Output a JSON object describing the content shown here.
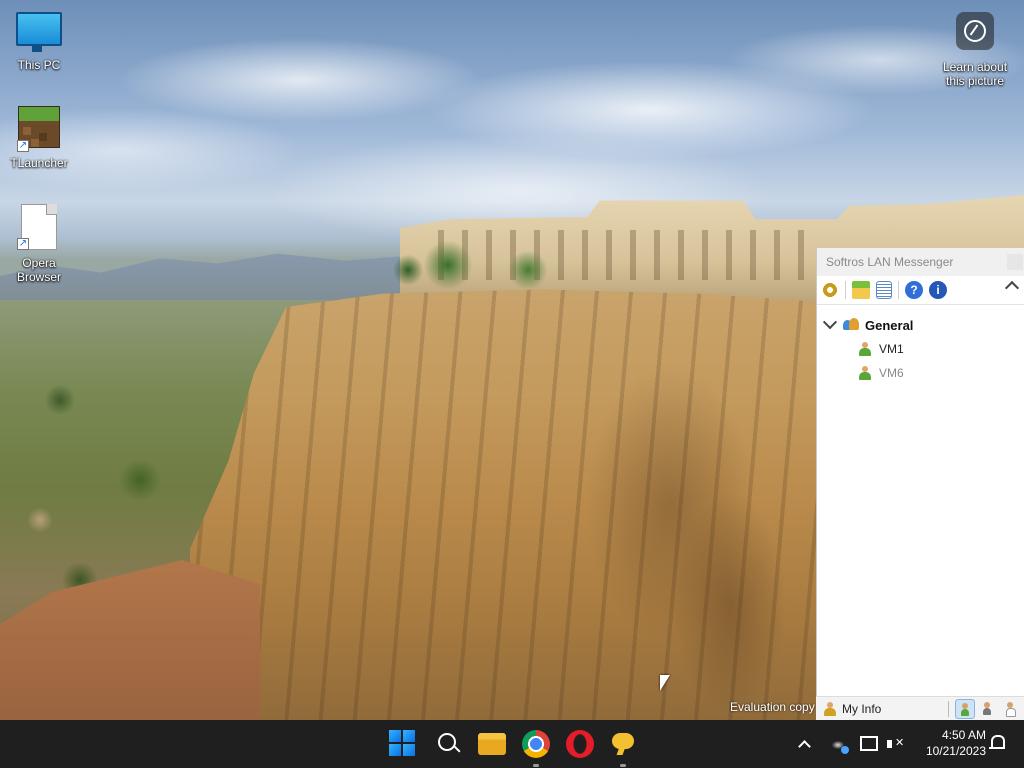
{
  "desktop": {
    "icons": [
      {
        "label": "This PC"
      },
      {
        "label": "TLauncher"
      },
      {
        "label": "Opera Browser"
      }
    ],
    "learn_picture": {
      "label": "Learn about this picture"
    },
    "evaluation_text": "Evaluation copy"
  },
  "messenger": {
    "title": "Softros LAN Messenger",
    "toolbar": [
      "settings-icon",
      "folder-icon",
      "notes-icon",
      "help-icon",
      "info-icon"
    ],
    "groups": [
      {
        "name": "General",
        "users": [
          {
            "name": "VM1",
            "status": "online"
          },
          {
            "name": "VM6",
            "status": "away"
          }
        ]
      }
    ],
    "status": {
      "my_info_label": "My Info"
    }
  },
  "taskbar": {
    "apps": [
      "start",
      "search",
      "file-explorer",
      "chrome",
      "opera",
      "softros-messenger"
    ],
    "clock": {
      "time": "4:50 AM",
      "date": "10/21/2023"
    }
  },
  "colors": {
    "taskbar_bg": "#1f1f1f",
    "messenger_title_text": "#8a8a8a"
  }
}
